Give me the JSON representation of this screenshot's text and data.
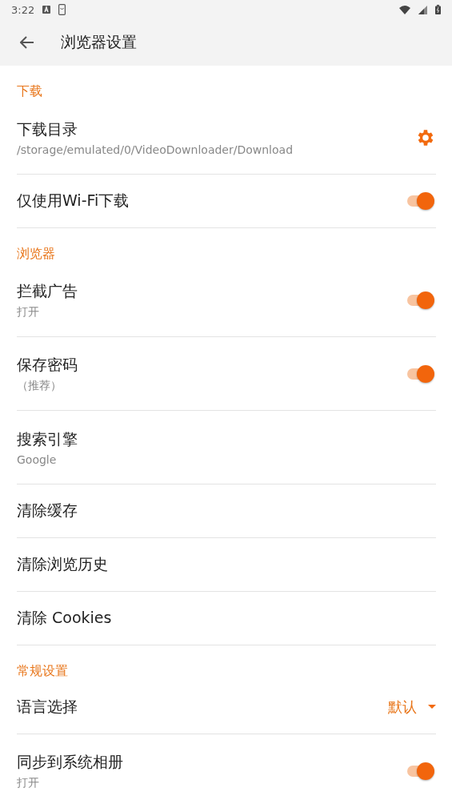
{
  "status_bar": {
    "time": "3:22"
  },
  "toolbar": {
    "title": "浏览器设置"
  },
  "sections": [
    {
      "title": "下载",
      "items": [
        {
          "kind": "gear",
          "title": "下载目录",
          "subtitle": "/storage/emulated/0/VideoDownloader/Download"
        },
        {
          "kind": "switch",
          "title": "仅使用Wi-Fi下载",
          "on": true
        }
      ]
    },
    {
      "title": "浏览器",
      "items": [
        {
          "kind": "switch",
          "title": "拦截广告",
          "subtitle": "打开",
          "on": true
        },
        {
          "kind": "switch",
          "title": "保存密码",
          "subtitle": "（推荐）",
          "on": true
        },
        {
          "kind": "plain",
          "title": "搜索引擎",
          "subtitle": "Google"
        },
        {
          "kind": "plain",
          "title": "清除缓存"
        },
        {
          "kind": "plain",
          "title": "清除浏览历史"
        },
        {
          "kind": "plain",
          "title": "清除 Cookies"
        }
      ]
    },
    {
      "title": "常规设置",
      "items": [
        {
          "kind": "dropdown",
          "title": "语言选择",
          "value": "默认"
        },
        {
          "kind": "switch",
          "title": "同步到系统相册",
          "subtitle": "打开",
          "on": true
        }
      ]
    }
  ]
}
